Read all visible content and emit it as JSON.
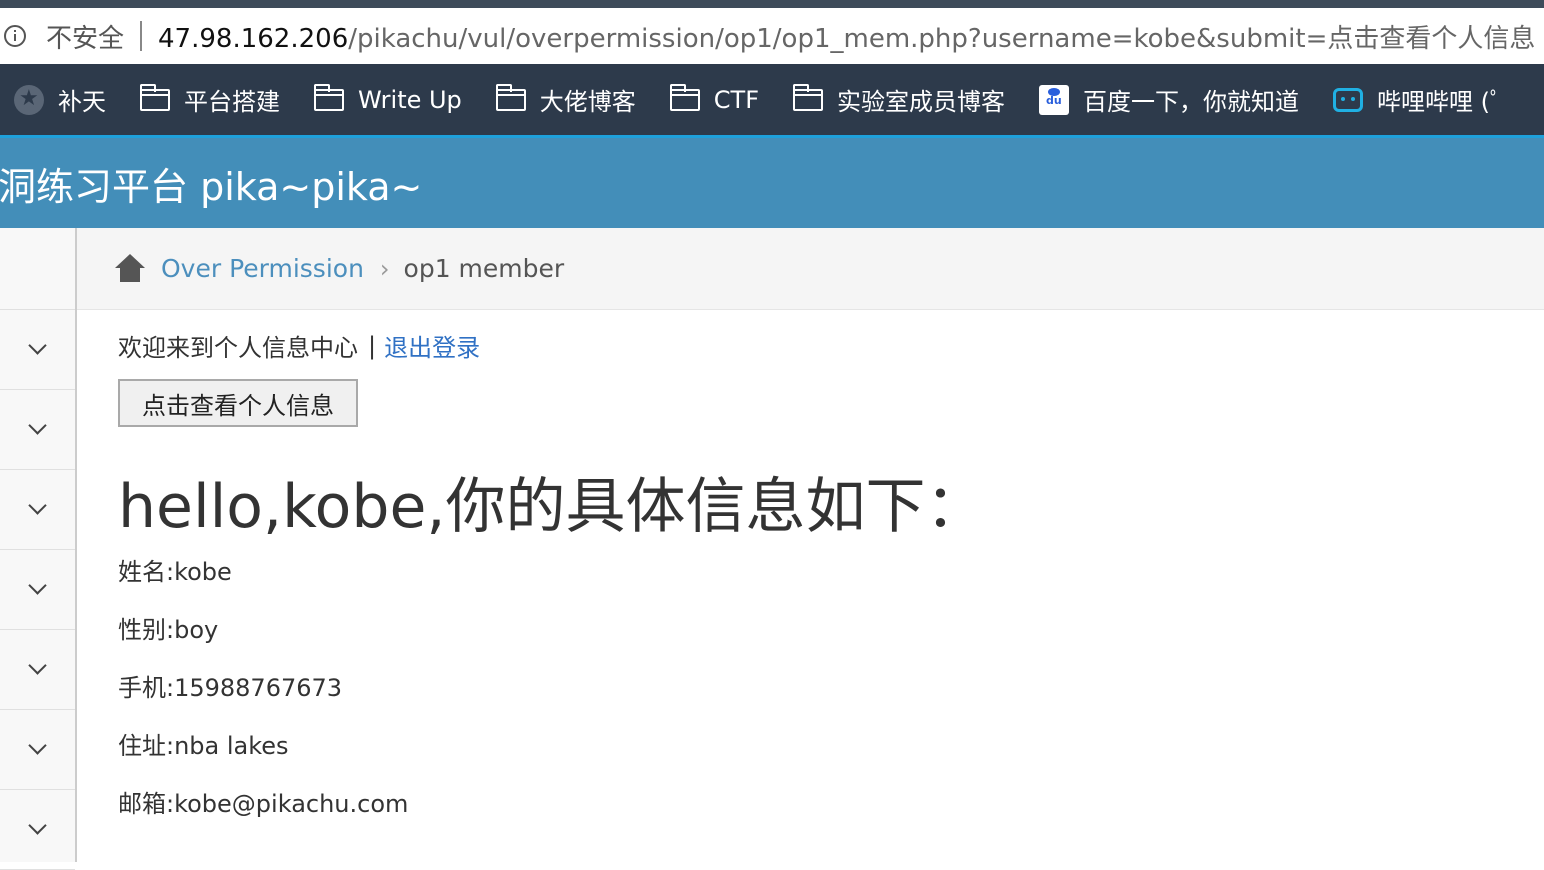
{
  "browser": {
    "insecure_label": "不安全",
    "url_host": "47.98.162.206",
    "url_path": "/pikachu/vul/overpermission/op1/op1_mem.php?username=kobe&submit=点击查看个人信息"
  },
  "bookmarks": [
    {
      "label": "补天",
      "icon": "star-icon"
    },
    {
      "label": "平台搭建",
      "icon": "folder-icon"
    },
    {
      "label": "Write Up",
      "icon": "folder-icon"
    },
    {
      "label": "大佬博客",
      "icon": "folder-icon"
    },
    {
      "label": "CTF",
      "icon": "folder-icon"
    },
    {
      "label": "实验室成员博客",
      "icon": "folder-icon"
    },
    {
      "label": "百度一下，你就知道",
      "icon": "baidu-icon"
    },
    {
      "label": "哔哩哔哩 (ﾟ",
      "icon": "bilibili-icon"
    }
  ],
  "header": {
    "brand": "洞练习平台 pika~pika~"
  },
  "breadcrumb": {
    "parent": "Over Permission",
    "current": "op1 member"
  },
  "welcome": {
    "text": "欢迎来到个人信息中心",
    "separator": "|",
    "logout_label": "退出登录"
  },
  "view_button_label": "点击查看个人信息",
  "greeting": "hello,kobe,你的具体信息如下：",
  "profile": {
    "name": "姓名:kobe",
    "gender": "性别:boy",
    "phone": "手机:15988767673",
    "address": "住址:nba lakes",
    "email": "邮箱:kobe@pikachu.com"
  }
}
